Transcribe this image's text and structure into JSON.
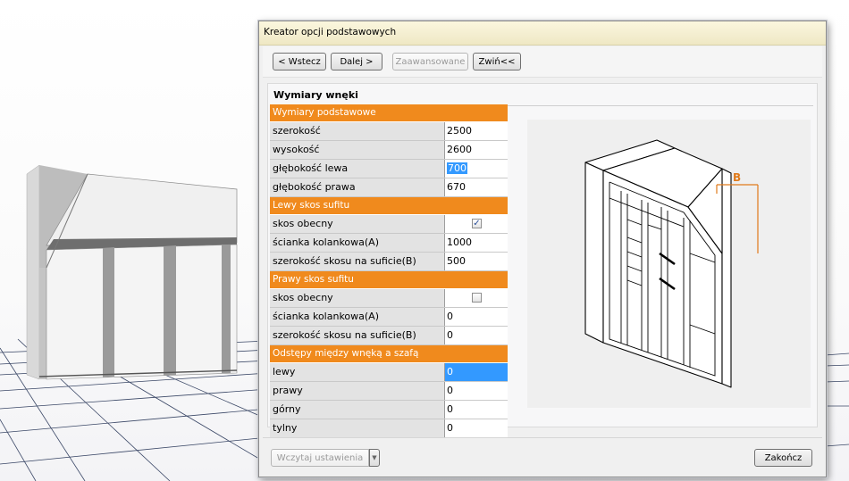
{
  "window": {
    "title": "Kreator opcji podstawowych"
  },
  "toolbar": {
    "back_label": "< Wstecz",
    "next_label": "Dalej >",
    "advanced_label": "Zaawansowane",
    "collapse_label": "Zwiń<<"
  },
  "panel": {
    "title": "Wymiary wnęki"
  },
  "grid": {
    "sections": [
      {
        "title": "Wymiary podstawowe",
        "rows": [
          {
            "label": "szerokość",
            "value": "2500"
          },
          {
            "label": "wysokość",
            "value": "2600"
          },
          {
            "label": "głębokość lewa",
            "value": "700"
          },
          {
            "label": "głębokość prawa",
            "value": "670"
          }
        ]
      },
      {
        "title": "Lewy skos sufitu",
        "rows": [
          {
            "label": "skos obecny",
            "checked": true
          },
          {
            "label": "ścianka kolankowa(A)",
            "value": "1000"
          },
          {
            "label": "szerokość skosu na suficie(B)",
            "value": "500"
          }
        ]
      },
      {
        "title": "Prawy skos sufitu",
        "rows": [
          {
            "label": "skos obecny",
            "checked": false
          },
          {
            "label": "ścianka kolankowa(A)",
            "value": "0"
          },
          {
            "label": "szerokość skosu na suficie(B)",
            "value": "0"
          }
        ]
      },
      {
        "title": "Odstępy między wnęką a szafą",
        "rows": [
          {
            "label": "lewy",
            "value": "0"
          },
          {
            "label": "prawy",
            "value": "0"
          },
          {
            "label": "górny",
            "value": "0"
          },
          {
            "label": "tylny",
            "value": "0"
          }
        ]
      }
    ]
  },
  "preview": {
    "dimension_label": "B"
  },
  "footer": {
    "load_settings_label": "Wczytaj ustawienia",
    "finish_label": "Zakończ"
  },
  "colors": {
    "section_header": "#f08a1d",
    "selection": "#3399ff",
    "dimension": "#e07a1a"
  }
}
